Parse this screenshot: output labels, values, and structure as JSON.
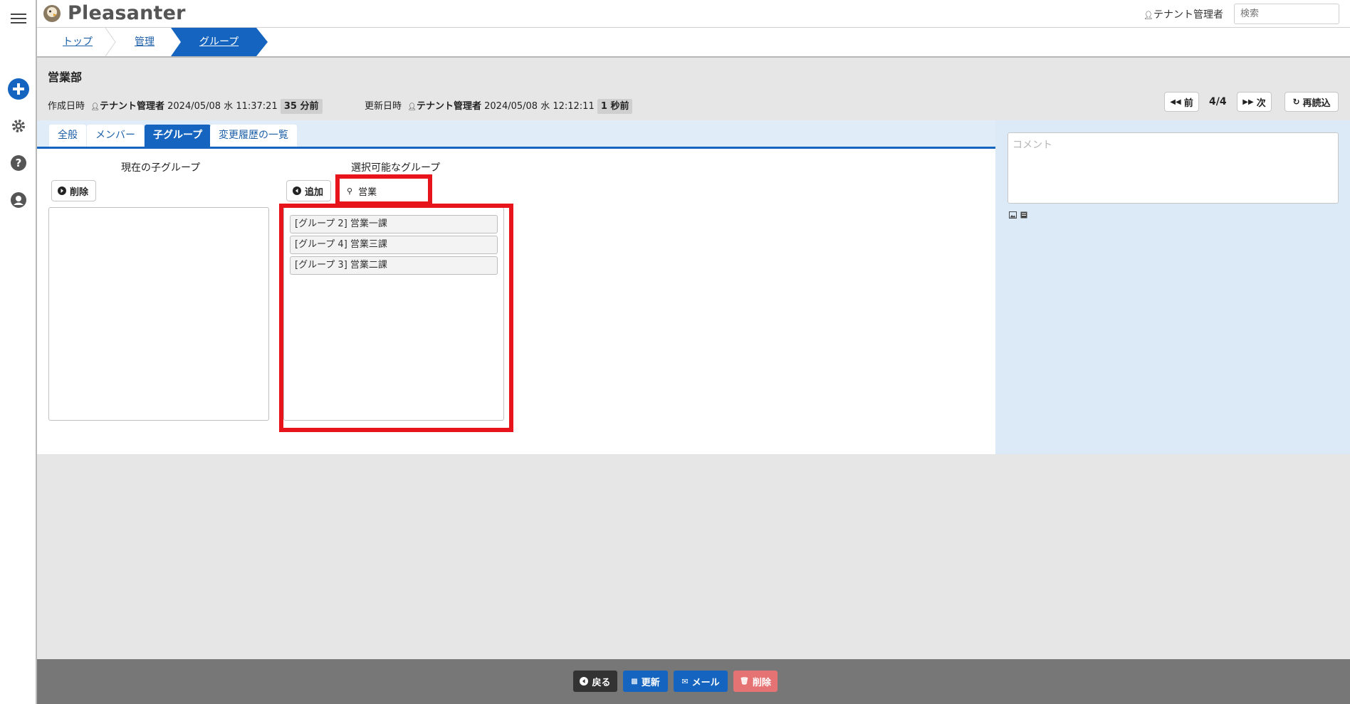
{
  "app": {
    "logo_text": "Pleasanter"
  },
  "header": {
    "user_label": "テナント管理者",
    "search_placeholder": "検索"
  },
  "breadcrumb": {
    "items": [
      "トップ",
      "管理",
      "グループ"
    ]
  },
  "record": {
    "title": "営業部",
    "created_label": "作成日時",
    "created_user": "テナント管理者",
    "created_at": "2024/05/08 水 11:37:21",
    "created_ago": "35 分前",
    "updated_label": "更新日時",
    "updated_user": "テナント管理者",
    "updated_at": "2024/05/08 水 12:12:11",
    "updated_ago": "1 秒前"
  },
  "pager": {
    "prev_label": "前",
    "position": "4/4",
    "next_label": "次",
    "reload_label": "再読込"
  },
  "tabs": [
    {
      "label": "全般",
      "active": false
    },
    {
      "label": "メンバー",
      "active": false
    },
    {
      "label": "子グループ",
      "active": true
    },
    {
      "label": "変更履歴の一覧",
      "active": false
    }
  ],
  "child_groups": {
    "current_title": "現在の子グループ",
    "delete_label": "削除",
    "current_items": [],
    "selectable_title": "選択可能なグループ",
    "add_label": "追加",
    "search_value": "営業",
    "selectable_items": [
      "[グループ 2] 営業一課",
      "[グループ 4] 営業三課",
      "[グループ 3] 営業二課"
    ]
  },
  "comment": {
    "placeholder": "コメント"
  },
  "footer": {
    "back_label": "戻る",
    "update_label": "更新",
    "mail_label": "メール",
    "delete_label": "削除"
  },
  "colors": {
    "accent": "#1565c0",
    "highlight": "#e8141c",
    "danger": "#e57373",
    "footer_bg": "#777777"
  }
}
